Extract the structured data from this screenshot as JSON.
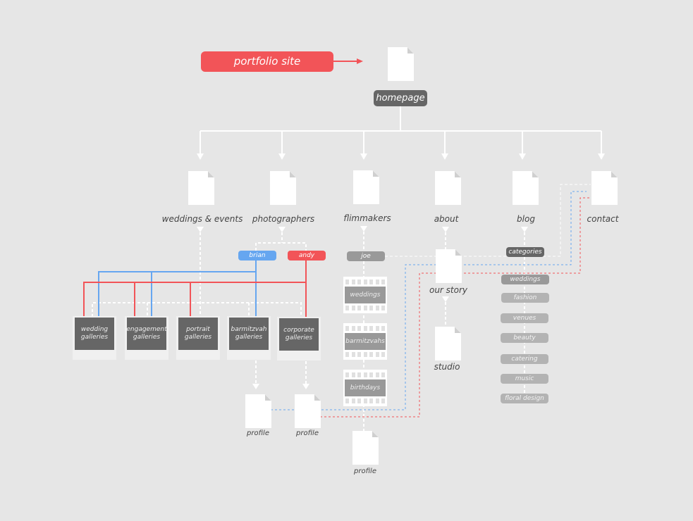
{
  "title": "portfolio site",
  "root": {
    "label": "homepage"
  },
  "top_level_pages": [
    {
      "id": "weddings-events",
      "label": "weddings & events"
    },
    {
      "id": "photographers",
      "label": "photographers"
    },
    {
      "id": "flimmakers",
      "label": "flimmakers"
    },
    {
      "id": "about",
      "label": "about"
    },
    {
      "id": "blog",
      "label": "blog"
    },
    {
      "id": "contact",
      "label": "contact"
    }
  ],
  "photographers": [
    {
      "name": "brian",
      "color": "#66a6f0"
    },
    {
      "name": "andy",
      "color": "#f25458"
    }
  ],
  "galleries": [
    {
      "line1": "wedding",
      "line2": "galleries"
    },
    {
      "line1": "engagement",
      "line2": "galleries"
    },
    {
      "line1": "portrait",
      "line2": "galleries"
    },
    {
      "line1": "barmitzvah",
      "line2": "galleries"
    },
    {
      "line1": "corporate",
      "line2": "galleries"
    }
  ],
  "photographer_profiles": [
    {
      "label": "profile"
    },
    {
      "label": "profile"
    }
  ],
  "filmmakers": {
    "name": "joe",
    "reels": [
      "weddings",
      "barmitzvahs",
      "birthdays"
    ],
    "profile_label": "profile"
  },
  "about": {
    "children": [
      {
        "label": "our story"
      },
      {
        "label": "studio"
      }
    ]
  },
  "blog": {
    "categories_label": "categories",
    "categories": [
      "weddings",
      "fashion",
      "venues",
      "beauty",
      "catering",
      "music",
      "floral design"
    ]
  },
  "colors": {
    "background": "#e6e6e6",
    "accent_red": "#f25458",
    "accent_blue": "#66a6f0",
    "node_dark": "#666666",
    "node_mid": "#999999",
    "node_light": "#b3b3b3"
  }
}
